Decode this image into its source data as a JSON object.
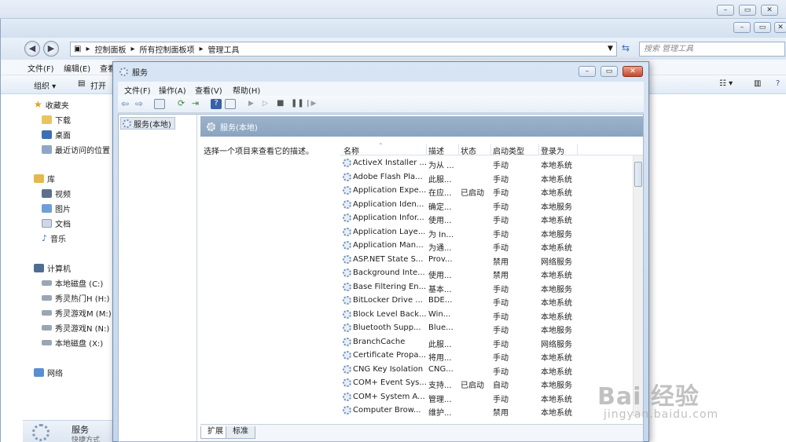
{
  "explorer": {
    "breadcrumb": [
      "控制面板",
      "所有控制面板项",
      "管理工具"
    ],
    "search_placeholder": "搜索 管理工具",
    "menu": [
      "文件(F)",
      "编辑(E)",
      "查看"
    ],
    "toolbar": {
      "organize": "组织 ▾",
      "open": "打开"
    },
    "sidebar": {
      "favorites_header": "收藏夹",
      "favorites": [
        "下载",
        "桌面",
        "最近访问的位置"
      ],
      "library_header": "库",
      "library": [
        "视频",
        "图片",
        "文档",
        "音乐"
      ],
      "computer_header": "计算机",
      "drives": [
        "本地磁盘 (C:)",
        "秀灵热门H (H:)",
        "秀灵游戏M (M:)",
        "秀灵游戏N (N:)",
        "本地磁盘 (X:)"
      ],
      "network": "网络"
    },
    "details": {
      "title": "服务",
      "subtitle": "快捷方式"
    }
  },
  "services": {
    "title": "服务",
    "menu": [
      "文件(F)",
      "操作(A)",
      "查看(V)",
      "帮助(H)"
    ],
    "tree_item": "服务(本地)",
    "header_title": "服务(本地)",
    "description_hint": "选择一个项目来查看它的描述。",
    "columns": [
      "名称",
      "描述",
      "状态",
      "启动类型",
      "登录为"
    ],
    "rows": [
      {
        "name": "ActiveX Installer ...",
        "desc": "为从 ...",
        "status": "",
        "start": "手动",
        "logon": "本地系统"
      },
      {
        "name": "Adobe Flash Pla...",
        "desc": "此服...",
        "status": "",
        "start": "手动",
        "logon": "本地系统"
      },
      {
        "name": "Application Expe...",
        "desc": "在应...",
        "status": "已启动",
        "start": "手动",
        "logon": "本地系统"
      },
      {
        "name": "Application Iden...",
        "desc": "确定...",
        "status": "",
        "start": "手动",
        "logon": "本地服务"
      },
      {
        "name": "Application Infor...",
        "desc": "使用...",
        "status": "",
        "start": "手动",
        "logon": "本地系统"
      },
      {
        "name": "Application Laye...",
        "desc": "为 In...",
        "status": "",
        "start": "手动",
        "logon": "本地服务"
      },
      {
        "name": "Application Man...",
        "desc": "为通...",
        "status": "",
        "start": "手动",
        "logon": "本地系统"
      },
      {
        "name": "ASP.NET State S...",
        "desc": "Prov...",
        "status": "",
        "start": "禁用",
        "logon": "网络服务"
      },
      {
        "name": "Background Inte...",
        "desc": "使用...",
        "status": "",
        "start": "禁用",
        "logon": "本地系统"
      },
      {
        "name": "Base Filtering En...",
        "desc": "基本...",
        "status": "",
        "start": "手动",
        "logon": "本地服务"
      },
      {
        "name": "BitLocker Drive ...",
        "desc": "BDE...",
        "status": "",
        "start": "手动",
        "logon": "本地系统"
      },
      {
        "name": "Block Level Back...",
        "desc": "Win...",
        "status": "",
        "start": "手动",
        "logon": "本地系统"
      },
      {
        "name": "Bluetooth Supp...",
        "desc": "Blue...",
        "status": "",
        "start": "手动",
        "logon": "本地服务"
      },
      {
        "name": "BranchCache",
        "desc": "此服...",
        "status": "",
        "start": "手动",
        "logon": "网络服务"
      },
      {
        "name": "Certificate Propa...",
        "desc": "将用...",
        "status": "",
        "start": "手动",
        "logon": "本地系统"
      },
      {
        "name": "CNG Key Isolation",
        "desc": "CNG...",
        "status": "",
        "start": "手动",
        "logon": "本地系统"
      },
      {
        "name": "COM+ Event Sys...",
        "desc": "支持...",
        "status": "已启动",
        "start": "自动",
        "logon": "本地服务"
      },
      {
        "name": "COM+ System A...",
        "desc": "管理...",
        "status": "",
        "start": "手动",
        "logon": "本地系统"
      },
      {
        "name": "Computer Brow...",
        "desc": "维护...",
        "status": "",
        "start": "禁用",
        "logon": "本地系统"
      }
    ],
    "tabs": [
      "扩展",
      "标准"
    ]
  },
  "watermark": {
    "main": "Bai 经验",
    "sub": "jingyan.baidu.com"
  }
}
